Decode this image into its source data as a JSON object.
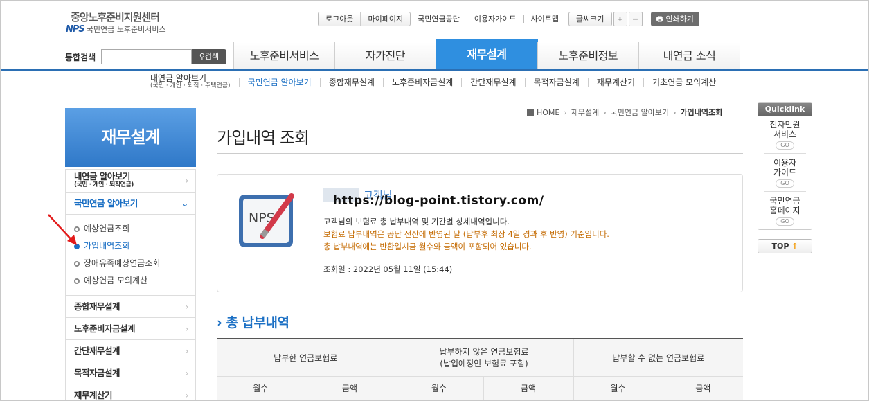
{
  "header": {
    "logo_title": "중앙노후준비지원센터",
    "logo_mark": "NPS",
    "logo_sub": "국민연금 노후준비서비스",
    "util": {
      "logout": "로그아웃",
      "mypage": "마이페이지",
      "nps": "국민연금공단",
      "guide": "이용자가이드",
      "sitemap": "사이트맵",
      "fontsize": "글씨크기",
      "plus": "+",
      "minus": "−",
      "print": "인쇄하기"
    },
    "search": {
      "label": "통합검색",
      "button": "검색",
      "value": ""
    }
  },
  "gnb": [
    "노후준비서비스",
    "자가진단",
    "재무설계",
    "노후준비정보",
    "내연금 소식"
  ],
  "subnav": {
    "first_main": "내연금 알아보기",
    "first_sub": "(국민 · 개인 · 퇴직 · 주택연금)",
    "items": [
      "국민연금 알아보기",
      "종합재무설계",
      "노후준비자금설계",
      "간단재무설계",
      "목적자금설계",
      "재무계산기",
      "기초연금 모의계산"
    ]
  },
  "lnb": {
    "title": "재무설계",
    "item0_main": "내연금 알아보기",
    "item0_sub": "(국민 · 개인  · 퇴직연금)",
    "item1": "국민연금 알아보기",
    "sub": [
      "예상연금조회",
      "가입내역조회",
      "장애유족예상연금조회",
      "예상연금 모의계산"
    ],
    "items": [
      "종합재무설계",
      "노후준비자금설계",
      "간단재무설계",
      "목적자금설계",
      "재무계산기"
    ],
    "chevron": "›",
    "chevron_open": "⌄"
  },
  "breadcrumb": {
    "home": "HOME",
    "l1": "재무설계",
    "l2": "국민연금 알아보기",
    "l3": "가입내역조회",
    "sep": "›"
  },
  "page_title": "가입내역 조회",
  "info": {
    "name_suffix": "고객님",
    "watermark": "https://blog-point.tistory.com/",
    "line1": "고객님의 보험료 총 납부내역 및 기간별 상세내역입니다.",
    "line2": "보험료 납부내역은 공단 전산에 반영된 날 (납부후 최장 4일 경과 후 반영) 기준입니다.",
    "line3": "총 납부내역에는 반환일시금 월수와 금액이 포함되어 있습니다.",
    "date": "조회일 : 2022년 05월 11일 (15:44)",
    "img_label": "NPS"
  },
  "section_title": "총 납부내역",
  "table": {
    "headers": [
      "납부한 연금보험료",
      "납부하지 않은 연금보험료",
      "(납입예정인 보험료 포함)",
      "납부할 수 없는 연금보험료"
    ],
    "sub": [
      "월수",
      "금액",
      "월수",
      "금액",
      "월수",
      "금액"
    ]
  },
  "quick": {
    "title": "Quicklink",
    "items": [
      {
        "l1": "전자민원",
        "l2": "서비스"
      },
      {
        "l1": "이용자",
        "l2": "가이드"
      },
      {
        "l1": "국민연금",
        "l2": "홈페이지"
      }
    ],
    "go": "GO",
    "top": "TOP",
    "top_arrow": "↑"
  },
  "colors": {
    "primary": "#2f8fe0",
    "navy": "#2b6fb4",
    "link": "#1a6fc4",
    "warn": "#c46a00"
  }
}
